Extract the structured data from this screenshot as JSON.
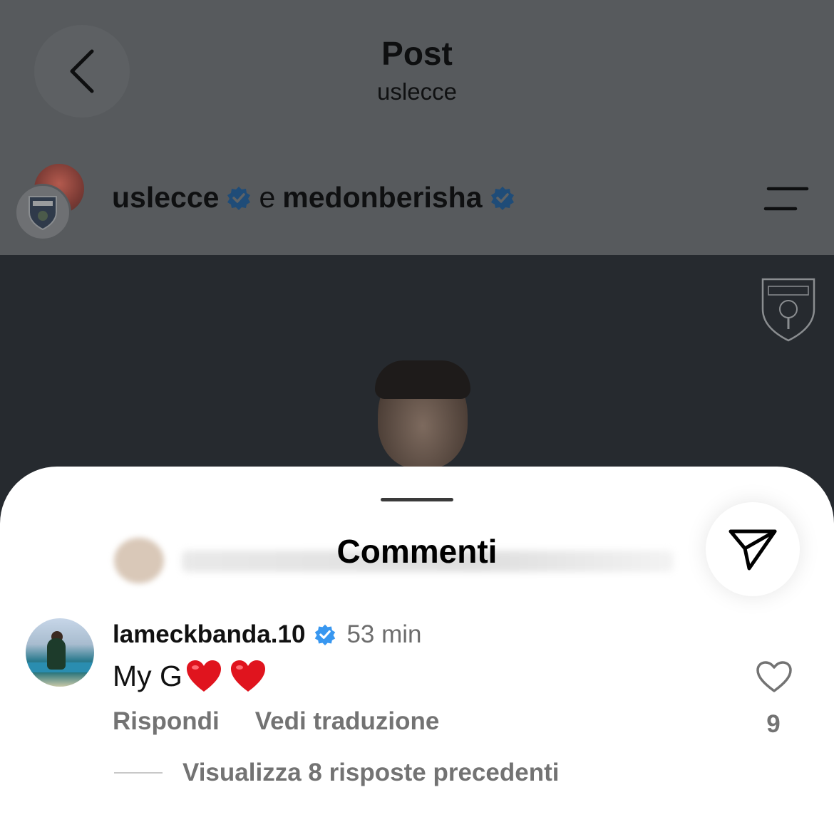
{
  "header": {
    "title": "Post",
    "subtitle": "uslecce",
    "back_icon": "chevron-left-icon"
  },
  "post": {
    "author_primary": "uslecce",
    "conjunction": "e",
    "author_secondary": "medonberisha",
    "verified_icon": "verified-badge-icon",
    "menu_icon": "menu-icon",
    "watermark_text": "U.S. LECCE"
  },
  "comments_sheet": {
    "title": "Commenti",
    "share_icon": "paper-plane-icon",
    "comment": {
      "username": "lameckbanda.10",
      "time": "53 min",
      "text": "My G",
      "emoji": [
        "❤️",
        "❤️"
      ],
      "reply_label": "Rispondi",
      "translate_label": "Vedi traduzione",
      "like_count": "9",
      "view_replies_label": "Visualizza 8 risposte precedenti"
    }
  },
  "colors": {
    "overlay": "#575a5d",
    "sheet": "#ffffff",
    "verified": "#3897f0",
    "secondary_text": "#737373",
    "heart": "#e0141e"
  }
}
